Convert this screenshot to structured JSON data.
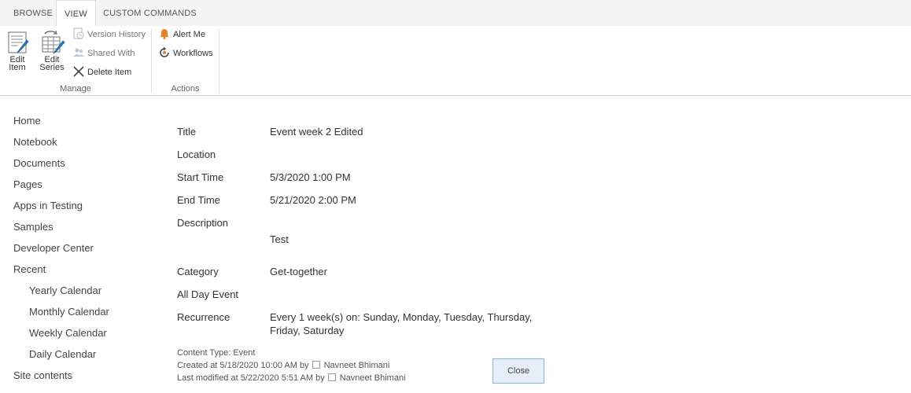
{
  "ribbon": {
    "tabs": [
      {
        "label": "BROWSE",
        "active": false
      },
      {
        "label": "VIEW",
        "active": true
      },
      {
        "label": "CUSTOM COMMANDS",
        "active": false
      }
    ],
    "manage": {
      "label": "Manage",
      "edit_item": [
        "Edit",
        "Item"
      ],
      "edit_series": [
        "Edit",
        "Series"
      ],
      "version_history": "Version History",
      "shared_with": "Shared With",
      "delete_item": "Delete Item"
    },
    "actions": {
      "label": "Actions",
      "alert_me": "Alert Me",
      "workflows": "Workflows"
    }
  },
  "nav": {
    "items": [
      {
        "label": "Home",
        "sub": false
      },
      {
        "label": "Notebook",
        "sub": false
      },
      {
        "label": "Documents",
        "sub": false
      },
      {
        "label": "Pages",
        "sub": false
      },
      {
        "label": "Apps in Testing",
        "sub": false
      },
      {
        "label": "Samples",
        "sub": false
      },
      {
        "label": "Developer Center",
        "sub": false
      },
      {
        "label": "Recent",
        "sub": false
      },
      {
        "label": "Yearly Calendar",
        "sub": true
      },
      {
        "label": "Monthly Calendar",
        "sub": true
      },
      {
        "label": "Weekly Calendar",
        "sub": true
      },
      {
        "label": "Daily Calendar",
        "sub": true
      },
      {
        "label": "Site contents",
        "sub": false
      }
    ]
  },
  "form": {
    "fields": [
      {
        "label": "Title",
        "value": "Event week 2 Edited"
      },
      {
        "label": "Location",
        "value": ""
      },
      {
        "label": "Start Time",
        "value": "5/3/2020 1:00 PM"
      },
      {
        "label": "End Time",
        "value": "5/21/2020 2:00 PM"
      },
      {
        "label": "Description",
        "value": "Test"
      },
      {
        "label": "Category",
        "value": "Get-together"
      },
      {
        "label": "All Day Event",
        "value": ""
      },
      {
        "label": "Recurrence",
        "value": "Every 1 week(s) on: Sunday, Monday, Tuesday, Thursday, Friday, Saturday"
      }
    ]
  },
  "footer": {
    "content_type": "Content Type: Event",
    "created_prefix": "Created at 5/18/2020 10:00 AM  by",
    "created_by": "Navneet Bhimani",
    "modified_prefix": "Last modified at 5/22/2020 5:51 AM  by",
    "modified_by": "Navneet Bhimani",
    "close_label": "Close"
  },
  "colors": {
    "accent_orange": "#e8812a",
    "button_fill": "#e6eef8",
    "button_border": "#8ab4e0",
    "icon_blue": "#2a78c8"
  }
}
